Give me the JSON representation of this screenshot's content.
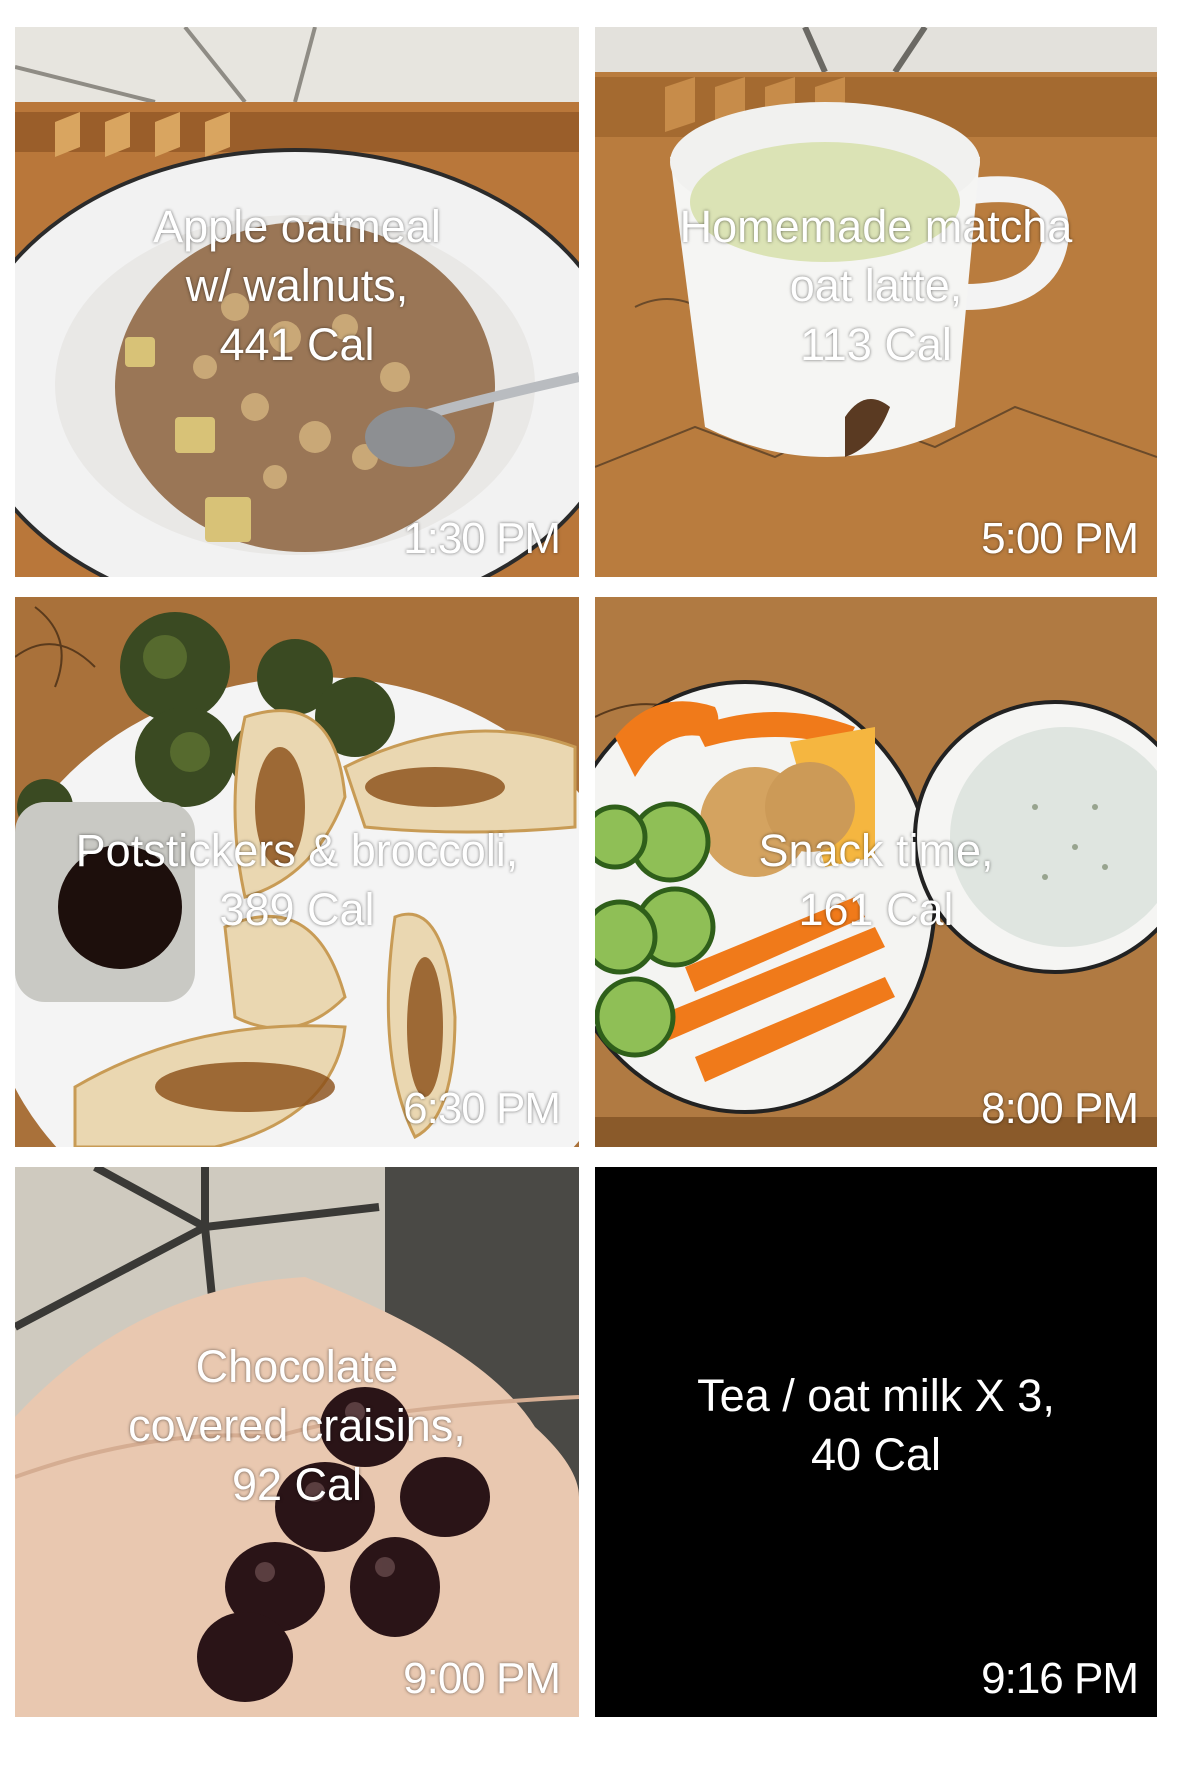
{
  "tiles": [
    {
      "caption": "Apple oatmeal\nw/ walnuts,\n441 Cal",
      "time": "1:30 PM"
    },
    {
      "caption": "Homemade matcha\noat latte,\n113 Cal",
      "time": "5:00 PM"
    },
    {
      "caption": "Potstickers & broccoli,\n389 Cal",
      "time": "6:30 PM"
    },
    {
      "caption": "Snack time,\n161 Cal",
      "time": "8:00 PM"
    },
    {
      "caption": "Chocolate\ncovered craisins,\n92 Cal",
      "time": "9:00 PM"
    },
    {
      "caption": "Tea / oat milk X 3,\n40 Cal",
      "time": "9:16 PM"
    }
  ],
  "colors": {
    "wood": "#b97c3e",
    "tile_black": "#000000",
    "text": "#ffffff"
  }
}
